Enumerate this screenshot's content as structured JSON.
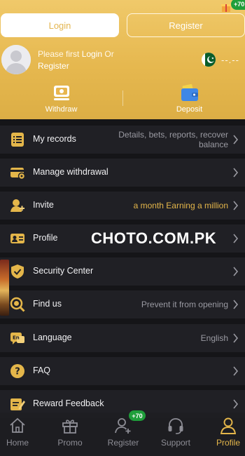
{
  "auth": {
    "login_label": "Login",
    "register_label": "Register",
    "promo_badge": "+70"
  },
  "user": {
    "prompt_prefix": "Please first ",
    "login_link": "Login",
    "prompt_or": " Or",
    "register_link": "Register",
    "balance": "--.--"
  },
  "quick_actions": [
    {
      "label": "Withdraw",
      "icon": "withdraw-icon"
    },
    {
      "label": "Deposit",
      "icon": "wallet-icon"
    }
  ],
  "menu": [
    {
      "label": "My records",
      "hint_line1": "Details, bets, reports, recover",
      "hint_line2": "balance",
      "icon": "records-icon"
    },
    {
      "label": "Manage withdrawal",
      "hint_line1": "",
      "icon": "card-icon"
    },
    {
      "label": "Invite",
      "hint_line1": "a month  Earning a million",
      "icon": "invite-icon"
    },
    {
      "label": "Profile",
      "hint_line1": "",
      "icon": "profile-card-icon"
    },
    {
      "label": "Security Center",
      "hint_line1": "",
      "icon": "shield-icon"
    },
    {
      "label": "Find us",
      "hint_line1": "Prevent it from opening",
      "icon": "find-icon"
    },
    {
      "label": "Language",
      "hint_line1": "English",
      "icon": "language-icon"
    },
    {
      "label": "FAQ",
      "hint_line1": "",
      "icon": "question-icon"
    },
    {
      "label": "Reward Feedback",
      "hint_line1": "",
      "icon": "feedback-icon"
    }
  ],
  "watermark": "CHOTO.COM.PK",
  "bottom_nav": [
    {
      "label": "Home",
      "icon": "home-icon"
    },
    {
      "label": "Promo",
      "icon": "gift-icon"
    },
    {
      "label": "Register",
      "icon": "add-user-icon",
      "badge": "+70"
    },
    {
      "label": "Support",
      "icon": "headset-icon"
    },
    {
      "label": "Profile",
      "icon": "person-icon",
      "active": true
    }
  ],
  "colors": {
    "accent": "#e4b64a",
    "header_top": "#f0c96a",
    "background": "#151518",
    "row": "#202025",
    "badge_green": "#1e9e3a"
  }
}
